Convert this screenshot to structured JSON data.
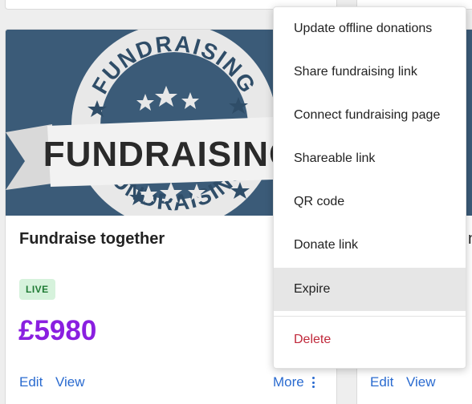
{
  "card": {
    "banner_text_big": "FUNDRAISING",
    "banner_text_arc_top": "FUNDRAISING",
    "banner_text_arc_bottom": "FUNDRAISING",
    "title": "Fundraise together",
    "status": "LIVE",
    "amount": "£5980",
    "edit_label": "Edit",
    "view_label": "View",
    "more_label": "More"
  },
  "right_card": {
    "title_fragment": "n",
    "edit_label": "Edit",
    "view_label": "View"
  },
  "menu": {
    "items": [
      {
        "label": "Update offline donations"
      },
      {
        "label": "Share fundraising link"
      },
      {
        "label": "Connect fundraising page"
      },
      {
        "label": "Shareable link"
      },
      {
        "label": "QR code"
      },
      {
        "label": "Donate link"
      },
      {
        "label": "Expire"
      },
      {
        "label": "Delete"
      }
    ]
  },
  "colors": {
    "amount": "#8a1fe0",
    "link": "#2a6bd0",
    "delete": "#c0283a",
    "live_bg": "#d6f2dc",
    "live_text": "#1f7a34",
    "banner_bg": "#3b5b78"
  }
}
